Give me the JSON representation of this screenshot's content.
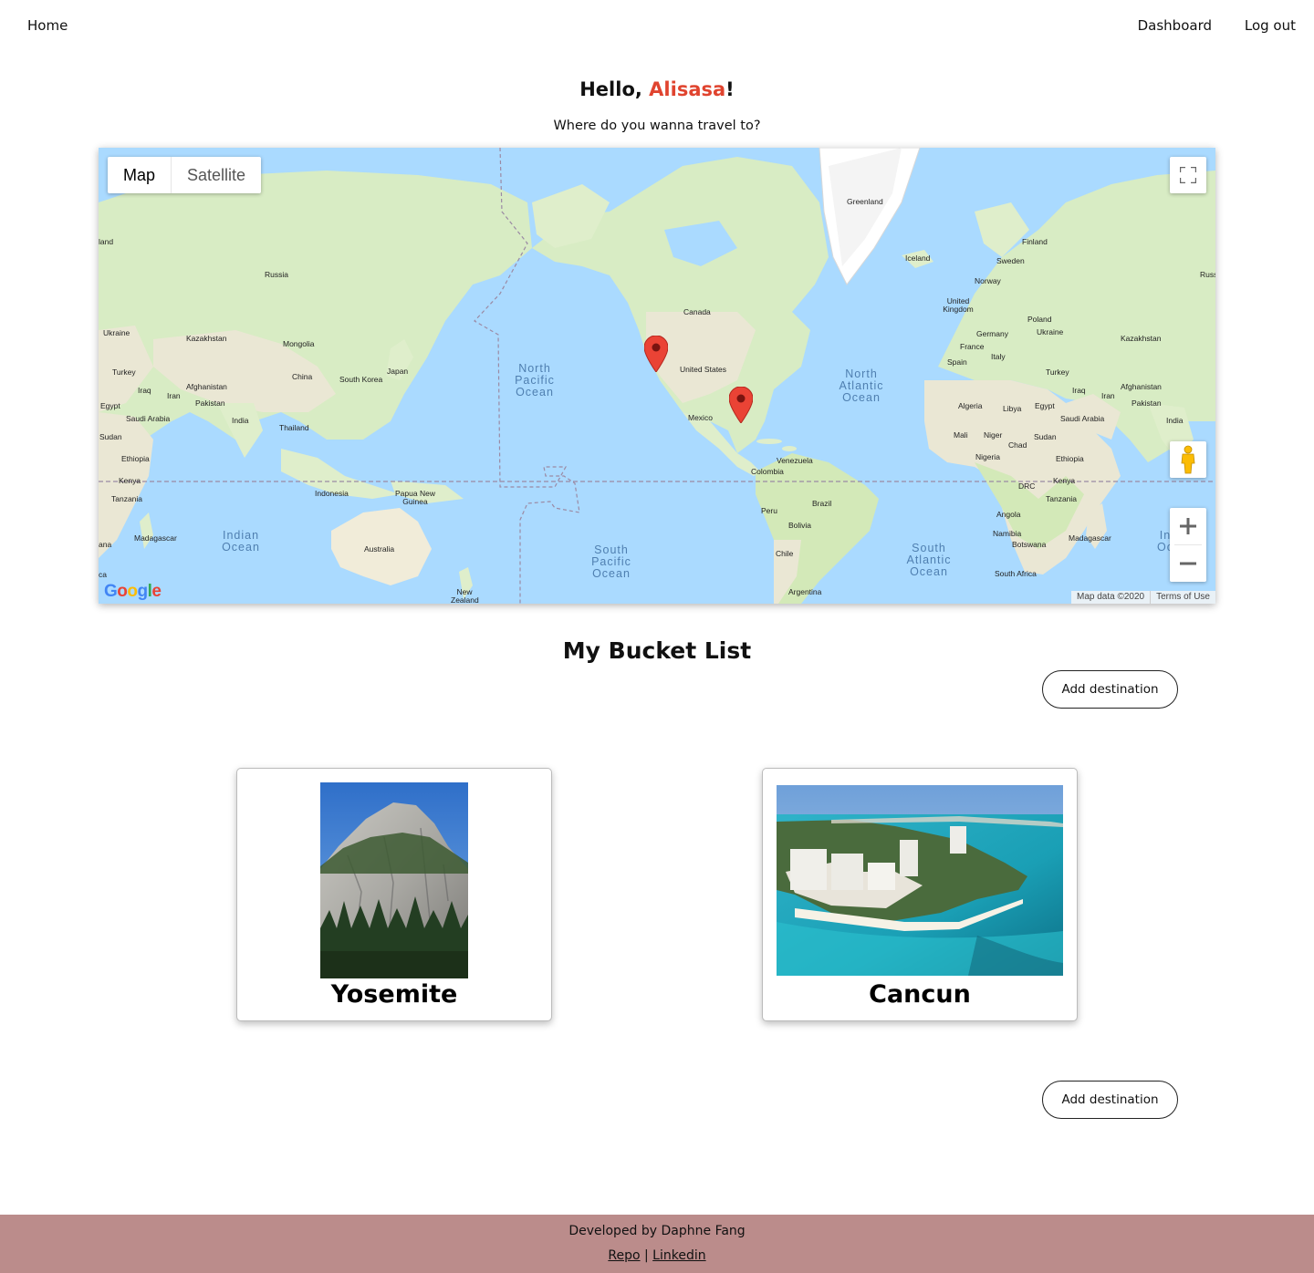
{
  "nav": {
    "home": "Home",
    "dashboard": "Dashboard",
    "logout": "Log out"
  },
  "greeting": {
    "prefix": "Hello, ",
    "name": "Alisasa",
    "suffix": "!",
    "name_color": "#e0442f"
  },
  "subtitle": "Where do you wanna travel to?",
  "map": {
    "type_buttons": [
      "Map",
      "Satellite"
    ],
    "active_type": "Map",
    "attribution": "Map data ©2020",
    "terms": "Terms of Use",
    "logo": "Google",
    "labels": {
      "greenland": "Greenland",
      "iceland": "Iceland",
      "finland": "Finland",
      "sweden": "Sweden",
      "norway": "Norway",
      "uk": "United Kingdom",
      "poland": "Poland",
      "ukraine_e": "Ukraine",
      "kazakhstan_e": "Kazakhstan",
      "germany": "Germany",
      "france": "France",
      "spain": "Spain",
      "italy": "Italy",
      "turkey_e": "Turkey",
      "iraq_e": "Iraq",
      "iran_e": "Iran",
      "afghanistan_e": "Afghanistan",
      "pakistan_e": "Pakistan",
      "india_e": "India",
      "saudi_e": "Saudi Arabia",
      "egypt_e": "Egypt",
      "algeria": "Algeria",
      "libya": "Libya",
      "mali": "Mali",
      "niger": "Niger",
      "chad": "Chad",
      "sudan_e": "Sudan",
      "nigeria": "Nigeria",
      "ethiopia_e": "Ethiopia",
      "kenya_e": "Kenya",
      "drc": "DRC",
      "tanzania_e": "Tanzania",
      "angola": "Angola",
      "namibia": "Namibia",
      "botswana": "Botswana",
      "madagascar_e": "Madagascar",
      "south_africa": "South Africa",
      "russia_e": "Russ",
      "canada": "Canada",
      "united_states": "United States",
      "mexico": "Mexico",
      "venezuela": "Venezuela",
      "colombia": "Colombia",
      "brazil": "Brazil",
      "peru": "Peru",
      "bolivia": "Bolivia",
      "chile": "Chile",
      "argentina": "Argentina",
      "russia": "Russia",
      "ukraine_w": "Ukraine",
      "kazakhstan_w": "Kazakhstan",
      "mongolia": "Mongolia",
      "china": "China",
      "south_korea": "South Korea",
      "japan": "Japan",
      "turkey_w": "Turkey",
      "iraq_w": "Iraq",
      "iran_w": "Iran",
      "afghanistan_w": "Afghanistan",
      "pakistan_w": "Pakistan",
      "india_w": "India",
      "thailand": "Thailand",
      "egypt_w": "Egypt",
      "saudi_w": "Saudi Arabia",
      "sudan_w": "Sudan",
      "ethiopia_w": "Ethiopia",
      "kenya_w": "Kenya",
      "tanzania_w": "Tanzania",
      "madagascar_w": "Madagascar",
      "indonesia": "Indonesia",
      "png": "Papua New Guinea",
      "australia": "Australia",
      "new_zealand": "New Zealand",
      "land_edge": "land",
      "ana_edge": "ana",
      "ca_edge": "ca"
    },
    "oceans": {
      "north_pacific": "North Pacific Ocean",
      "north_atlantic": "North Atlantic Ocean",
      "south_pacific": "South Pacific Ocean",
      "south_atlantic": "South Atlantic Ocean",
      "indian": "Indian Ocean",
      "indian_e": "In Oc"
    },
    "markers": [
      "Yosemite",
      "Cancun"
    ]
  },
  "bucket": {
    "title": "My Bucket List",
    "add_label": "Add destination",
    "destinations": [
      {
        "name": "Yosemite"
      },
      {
        "name": "Cancun"
      }
    ]
  },
  "footer": {
    "credit": "Developed by Daphne Fang",
    "repo": "Repo",
    "separator": "|",
    "linkedin": "Linkedin",
    "bg": "#bb8c8b"
  }
}
